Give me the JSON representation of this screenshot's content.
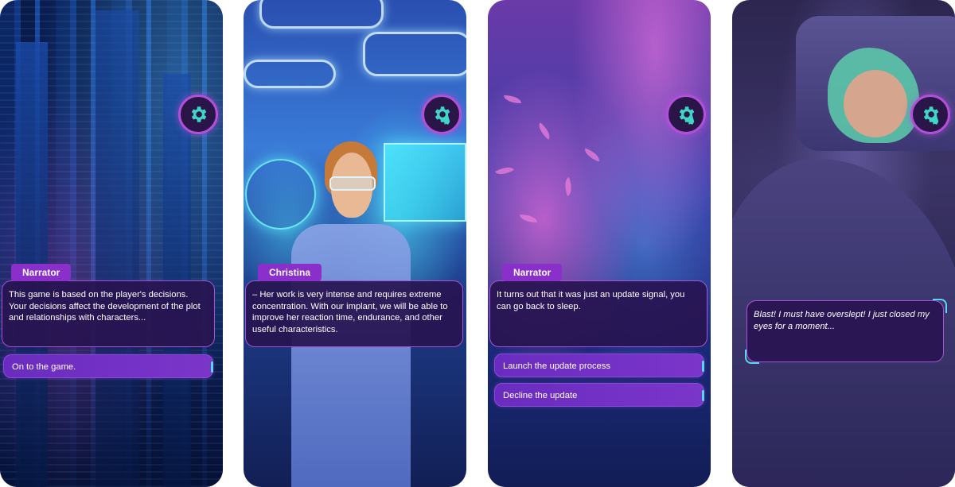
{
  "screens": [
    {
      "speaker": "Narrator",
      "text": "This game is based on the player's decisions. Your decisions affect the development of the plot and relationships with characters...",
      "choices": [
        "On to the game."
      ]
    },
    {
      "speaker": "Christina",
      "text": "– Her work is very intense and requires extreme concentration. With our implant, we will be able to improve her reaction time, endurance, and other useful characteristics.",
      "choices": []
    },
    {
      "speaker": "Narrator",
      "text": "It turns out that it was just an update signal, you can go back to sleep.",
      "choices": [
        "Launch the update process",
        "Decline the update"
      ]
    },
    {
      "speaker": "",
      "text": "Blast! I must have overslept! I just closed my eyes for a moment...",
      "choices": []
    }
  ],
  "icons": {
    "settings": "gear-icon"
  },
  "colors": {
    "accent": "#8a2fc9",
    "border": "#a653d8",
    "highlight": "#5ad6f0",
    "gear": "#3fd6c8"
  }
}
